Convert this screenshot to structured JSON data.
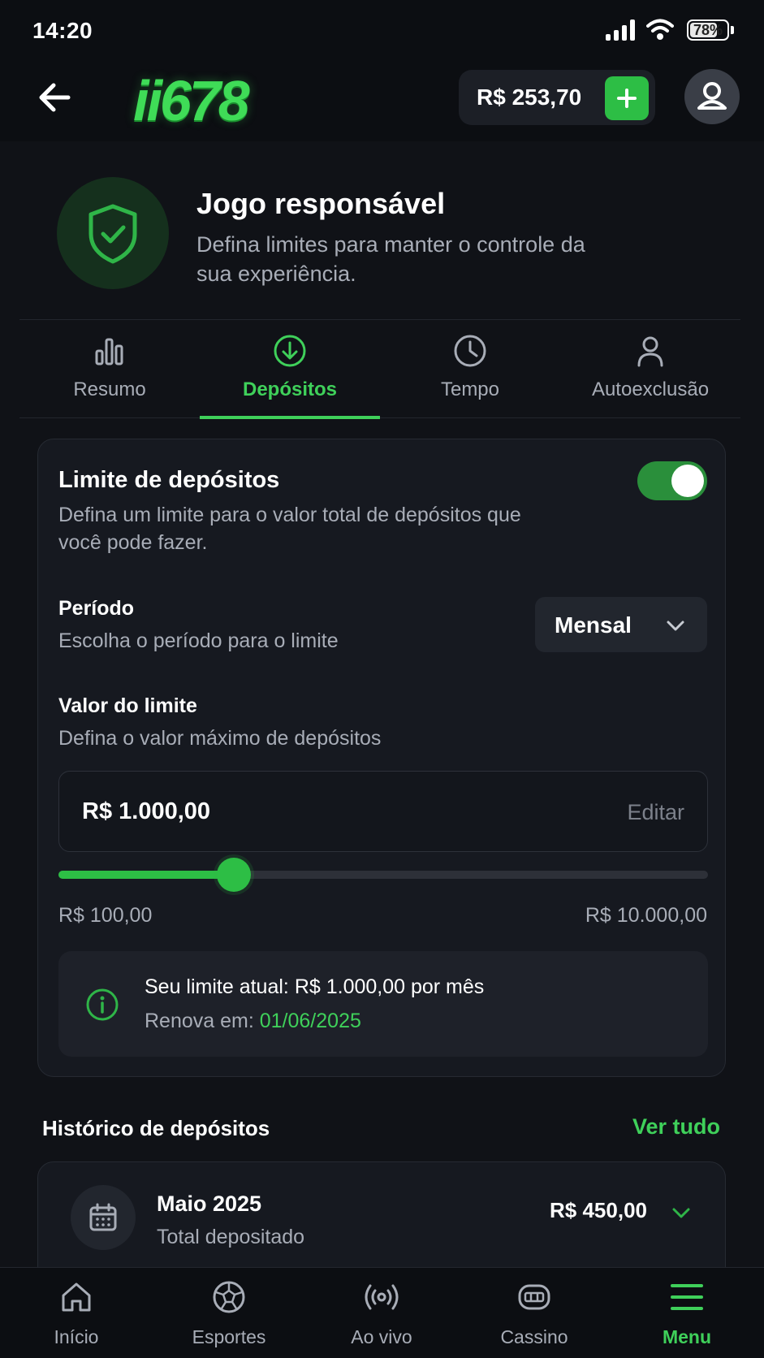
{
  "status_bar": {
    "time": "14:20",
    "battery": "78%",
    "battery_level": 0.78
  },
  "header": {
    "logo_text": "ii678",
    "balance": "R$ 253,70",
    "add_funds_icon": "plus-icon",
    "back_icon": "arrow-left-icon",
    "profile_icon": "user-icon"
  },
  "hero": {
    "icon": "shield-check-icon",
    "title": "Jogo responsável",
    "subtitle": "Defina limites para manter o controle da sua experiência."
  },
  "tabs": [
    {
      "label": "Resumo",
      "icon": "bar-chart-icon",
      "active": false
    },
    {
      "label": "Depósitos",
      "icon": "download-circle-icon",
      "active": true
    },
    {
      "label": "Tempo",
      "icon": "clock-icon",
      "active": false
    },
    {
      "label": "Autoexclusão",
      "icon": "person-icon",
      "active": false
    }
  ],
  "deposit_limit": {
    "title": "Limite de depósitos",
    "subtitle": "Defina um limite para o valor total de depósitos que você pode fazer.",
    "enabled": true,
    "period_label": "Período",
    "period_hint": "Escolha o período para o limite",
    "period_value": "Mensal",
    "value_label": "Valor do limite",
    "value_hint": "Defina o valor máximo de depósitos",
    "value_amount": "R$ 1.000,00",
    "edit_label": "Editar",
    "slider_min": "R$ 100,00",
    "slider_max": "R$ 10.000,00",
    "slider_fraction": 0.27,
    "info_line": "Seu limite atual: R$ 1.000,00 por mês",
    "renew_prefix": "Renova em: ",
    "renew_date": "01/06/2025"
  },
  "history": {
    "title": "Histórico de depósitos",
    "view_all": "Ver tudo",
    "items": [
      {
        "month": "Maio 2025",
        "label": "Total depositado",
        "amount": "R$ 450,00",
        "icon": "calendar-icon"
      }
    ]
  },
  "bottom_nav": [
    {
      "label": "Início",
      "icon": "home-icon",
      "active": false
    },
    {
      "label": "Esportes",
      "icon": "soccer-ball-icon",
      "active": false
    },
    {
      "label": "Ao vivo",
      "icon": "live-broadcast-icon",
      "active": false
    },
    {
      "label": "Cassino",
      "icon": "slot-machine-icon",
      "active": false
    },
    {
      "label": "Menu",
      "icon": "menu-icon",
      "active": true
    }
  ],
  "colors": {
    "accent": "#3fd05a",
    "background": "#101217",
    "card": "#161920"
  }
}
